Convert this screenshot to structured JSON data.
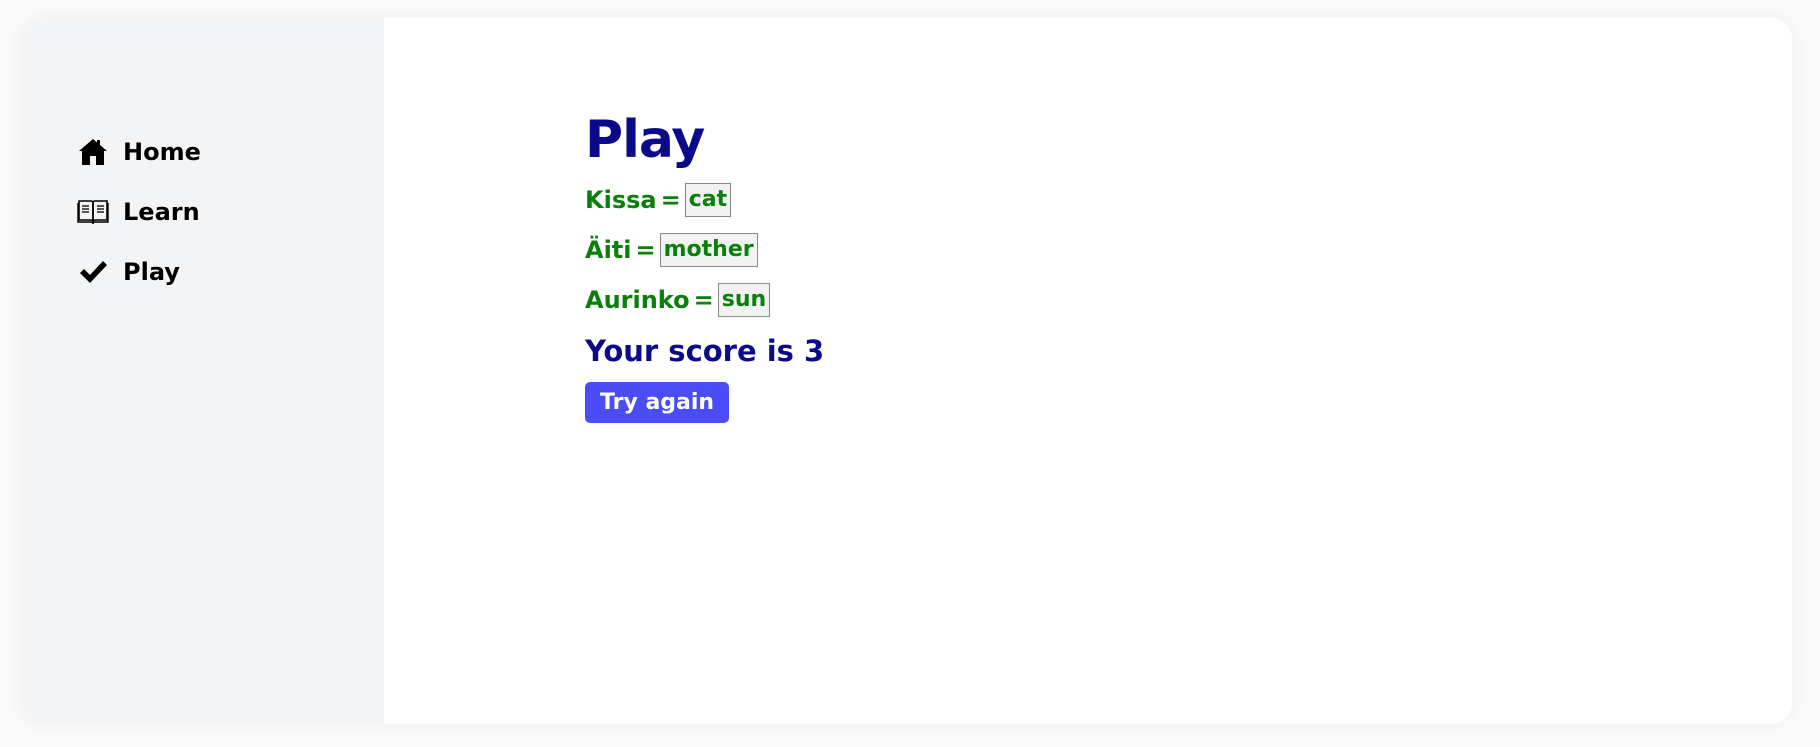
{
  "sidebar": {
    "items": [
      {
        "label": "Home",
        "icon": "home-icon"
      },
      {
        "label": "Learn",
        "icon": "book-icon"
      },
      {
        "label": "Play",
        "icon": "checkmark-icon"
      }
    ]
  },
  "main": {
    "title": "Play",
    "words": [
      {
        "finnish": "Kissa",
        "equals": "=",
        "answer": "cat"
      },
      {
        "finnish": "Äiti",
        "equals": "=",
        "answer": "mother"
      },
      {
        "finnish": "Aurinko",
        "equals": "=",
        "answer": "sun"
      }
    ],
    "score_text": "Your score is 3",
    "try_again_label": "Try again"
  },
  "colors": {
    "sidebar_bg": "#f3f4f6",
    "title": "#0b0a8a",
    "words": "#0a7f0a",
    "button": "#4a4df5"
  }
}
